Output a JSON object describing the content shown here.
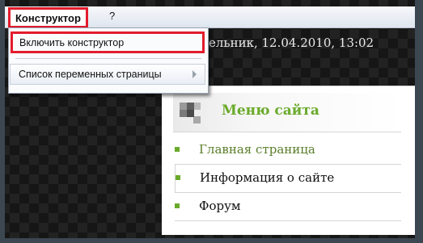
{
  "menubar": {
    "constructor_label": "Конструктор",
    "help_label": "?"
  },
  "dropdown": {
    "items": [
      {
        "label": "Включить конструктор"
      },
      {
        "label": "Список переменных страницы"
      }
    ]
  },
  "header": {
    "date_text": "ельник, 12.04.2010, 13:02"
  },
  "site_menu": {
    "title": "Меню сайта",
    "links": [
      {
        "label": "Главная страница",
        "color": "#5a7d2a"
      },
      {
        "label": "Информация о сайте"
      },
      {
        "label": "Форум"
      }
    ]
  },
  "colors": {
    "highlight": "#e31c2d",
    "accent": "#6aaa2a"
  },
  "icons": [
    "chevron-right-icon",
    "pixel-logo-icon",
    "bullet-icon"
  ]
}
